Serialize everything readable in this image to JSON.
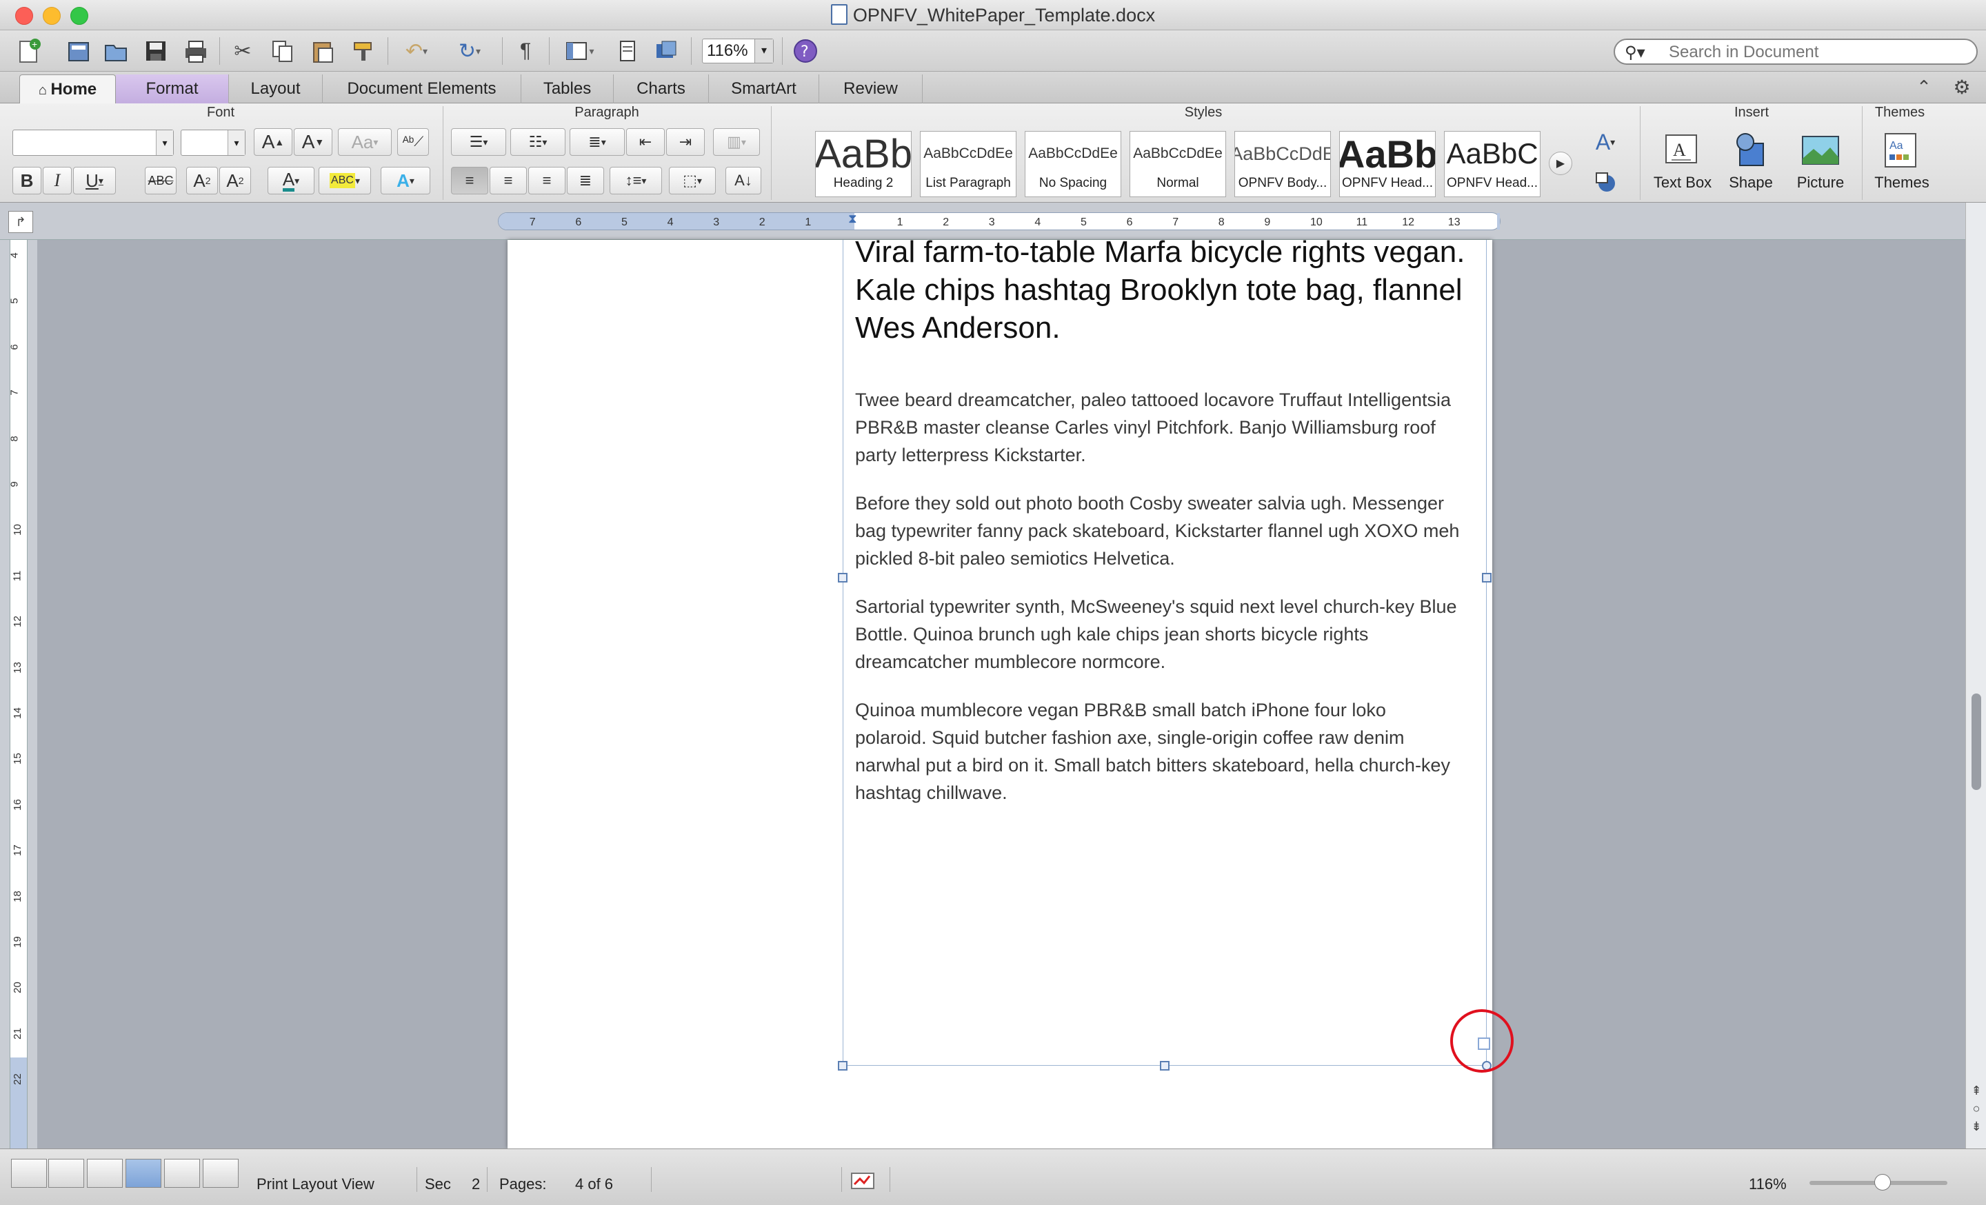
{
  "window": {
    "title": "OPNFV_WhitePaper_Template.docx"
  },
  "toolbar": {
    "zoom_value": "116%",
    "search_placeholder": "Search in Document"
  },
  "tabs": [
    {
      "label": "Home"
    },
    {
      "label": "Format"
    },
    {
      "label": "Layout"
    },
    {
      "label": "Document Elements"
    },
    {
      "label": "Tables"
    },
    {
      "label": "Charts"
    },
    {
      "label": "SmartArt"
    },
    {
      "label": "Review"
    }
  ],
  "ribbon": {
    "groups": {
      "font": "Font",
      "paragraph": "Paragraph",
      "styles": "Styles",
      "insert": "Insert",
      "themes": "Themes"
    },
    "styles": [
      {
        "preview": "AaBb",
        "name": "Heading 2"
      },
      {
        "preview": "AaBbCcDdEe",
        "name": "List Paragraph"
      },
      {
        "preview": "AaBbCcDdEe",
        "name": "No Spacing"
      },
      {
        "preview": "AaBbCcDdEe",
        "name": "Normal"
      },
      {
        "preview": "AaBbCcDdE",
        "name": "OPNFV Body..."
      },
      {
        "preview": "AaBb",
        "name": "OPNFV Head..."
      },
      {
        "preview": "AaBbC",
        "name": "OPNFV Head..."
      }
    ],
    "insert": [
      {
        "label": "Text Box"
      },
      {
        "label": "Shape"
      },
      {
        "label": "Picture"
      }
    ],
    "themes_label": "Themes"
  },
  "ruler": {
    "ticks": [
      "7",
      "6",
      "5",
      "4",
      "3",
      "2",
      "1",
      "1",
      "2",
      "3",
      "4",
      "5",
      "6",
      "7",
      "8",
      "9",
      "10",
      "11",
      "12",
      "13"
    ]
  },
  "vruler": {
    "ticks": [
      "4",
      "5",
      "6",
      "7",
      "8",
      "9",
      "10",
      "11",
      "12",
      "13",
      "14",
      "15",
      "16",
      "17",
      "18",
      "19",
      "20",
      "21",
      "22"
    ]
  },
  "document": {
    "heading": "Viral farm-to-table Marfa bicycle rights vegan. Kale chips hashtag Brooklyn tote bag, flannel Wes Anderson.",
    "paragraphs": [
      "Twee beard dreamcatcher, paleo tattooed locavore Truffaut Intelligentsia PBR&B master cleanse Carles vinyl Pitchfork. Banjo Williamsburg roof party letterpress Kickstarter.",
      "Before they sold out photo booth Cosby sweater salvia ugh. Messenger bag typewriter fanny pack skateboard, Kickstarter flannel ugh XOXO meh pickled 8-bit paleo semiotics Helvetica.",
      "Sartorial typewriter synth, McSweeney's squid next level church-key Blue Bottle. Quinoa brunch ugh kale chips jean shorts bicycle rights dreamcatcher mumblecore normcore.",
      "Quinoa mumblecore vegan PBR&B small batch iPhone four loko polaroid. Squid butcher fashion axe, single-origin coffee raw denim narwhal put a bird on it. Small batch bitters skateboard, hella church-key hashtag chillwave."
    ]
  },
  "status": {
    "view": "Print Layout View",
    "sec_label": "Sec",
    "sec_value": "2",
    "pages_label": "Pages:",
    "pages_value": "4 of 6",
    "zoom": "116%"
  },
  "colors": {
    "format_tab": "#c9b4e4",
    "selection_border": "#9db4d3",
    "annotation": "#e0101e"
  }
}
